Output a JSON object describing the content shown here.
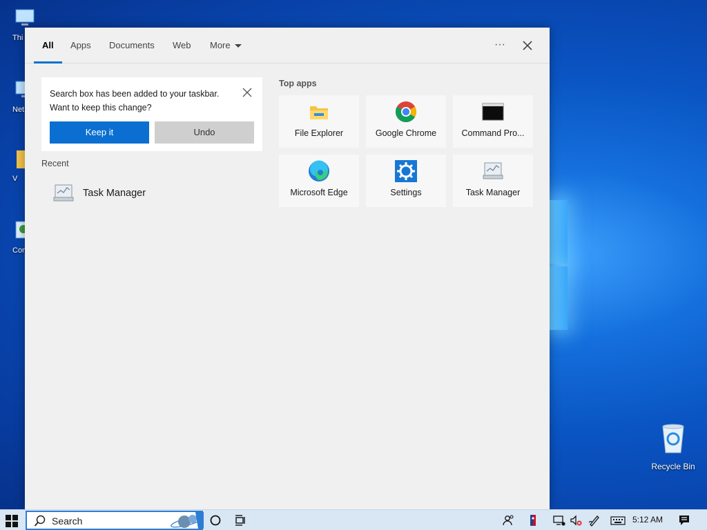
{
  "desktop": {
    "icons": [
      {
        "label": "Thi"
      },
      {
        "label": "Net"
      },
      {
        "label": "V"
      },
      {
        "label": "Contro"
      }
    ],
    "recycle_bin": {
      "label": "Recycle Bin"
    }
  },
  "search_panel": {
    "tabs": [
      {
        "label": "All",
        "active": true
      },
      {
        "label": "Apps"
      },
      {
        "label": "Documents"
      },
      {
        "label": "Web"
      },
      {
        "label": "More"
      }
    ],
    "more_options_label": "···",
    "notice": {
      "line1": "Search box has been added to your taskbar.",
      "line2": "Want to keep this change?",
      "keep_label": "Keep it",
      "undo_label": "Undo"
    },
    "recent": {
      "title": "Recent",
      "items": [
        {
          "label": "Task Manager",
          "icon": "task-manager-icon"
        }
      ]
    },
    "top_apps": {
      "title": "Top apps",
      "items": [
        {
          "label": "File Explorer",
          "icon": "file-explorer-icon"
        },
        {
          "label": "Google Chrome",
          "icon": "chrome-icon"
        },
        {
          "label": "Command Pro...",
          "icon": "command-prompt-icon"
        },
        {
          "label": "Microsoft Edge",
          "icon": "edge-icon"
        },
        {
          "label": "Settings",
          "icon": "settings-gear-icon"
        },
        {
          "label": "Task Manager",
          "icon": "task-manager-icon"
        }
      ]
    }
  },
  "taskbar": {
    "search_value": "Search",
    "clock": "5:12 AM"
  },
  "colors": {
    "accent": "#0a6fd0",
    "panel_bg": "#f0f0f0",
    "taskbar_bg": "#d9e6f4"
  }
}
